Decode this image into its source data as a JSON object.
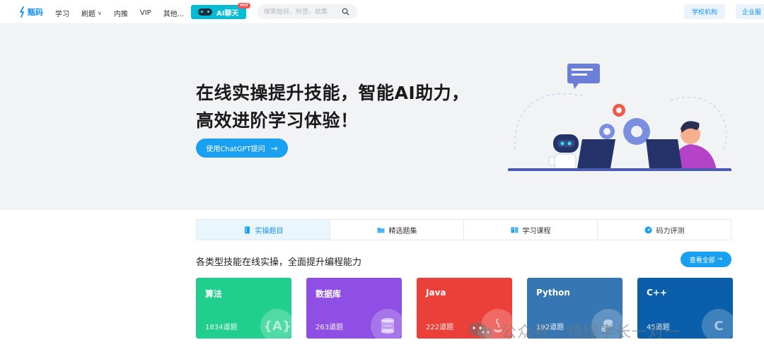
{
  "header": {
    "logo_text": "甄码",
    "nav": [
      {
        "label": "学习"
      },
      {
        "label": "刷题"
      },
      {
        "label": "内推"
      },
      {
        "label": "VIP"
      },
      {
        "label": "其他..."
      }
    ],
    "ai_chat_label": "AI聊天",
    "ai_badge": "HOT",
    "search_placeholder": "搜索题目、标签、题集",
    "school_button": "学校机构",
    "enterprise_button": "企业服"
  },
  "hero": {
    "title_line1": "在线实操提升技能，智能AI助力，",
    "title_line2": "高效进阶学习体验！",
    "cta_label": "使用ChatGPT提问"
  },
  "tabs": [
    {
      "label": "实操题目",
      "icon": "book-icon",
      "active": true
    },
    {
      "label": "精选题集",
      "icon": "folder-icon",
      "active": false
    },
    {
      "label": "学习课程",
      "icon": "open-book-icon",
      "active": false
    },
    {
      "label": "码力评测",
      "icon": "gauge-icon",
      "active": false
    }
  ],
  "section": {
    "title": "各类型技能在线实操，全面提升编程能力",
    "view_all": "查看全部"
  },
  "cards": [
    {
      "name": "算法",
      "count": "1834道题",
      "icon": "algorithm-icon",
      "glyph": "{A}",
      "color": "#20cf8e"
    },
    {
      "name": "数据库",
      "count": "263道题",
      "icon": "database-icon",
      "glyph": "",
      "color": "#8f4fe4"
    },
    {
      "name": "Java",
      "count": "222道题",
      "icon": "java-icon",
      "glyph": "",
      "color": "#eb3f3a"
    },
    {
      "name": "Python",
      "count": "192道题",
      "icon": "python-icon",
      "glyph": "",
      "color": "#3576b3"
    },
    {
      "name": "C++",
      "count": "45道题",
      "icon": "cpp-icon",
      "glyph": "C",
      "color": "#0a5eaa"
    }
  ],
  "watermark": {
    "text": "公众号 · 领绿学长一对一"
  },
  "colors": {
    "accent": "#1aa0f0",
    "hero_bg": "#f2f3f5",
    "tab_active_bg": "#eaf6fe"
  }
}
